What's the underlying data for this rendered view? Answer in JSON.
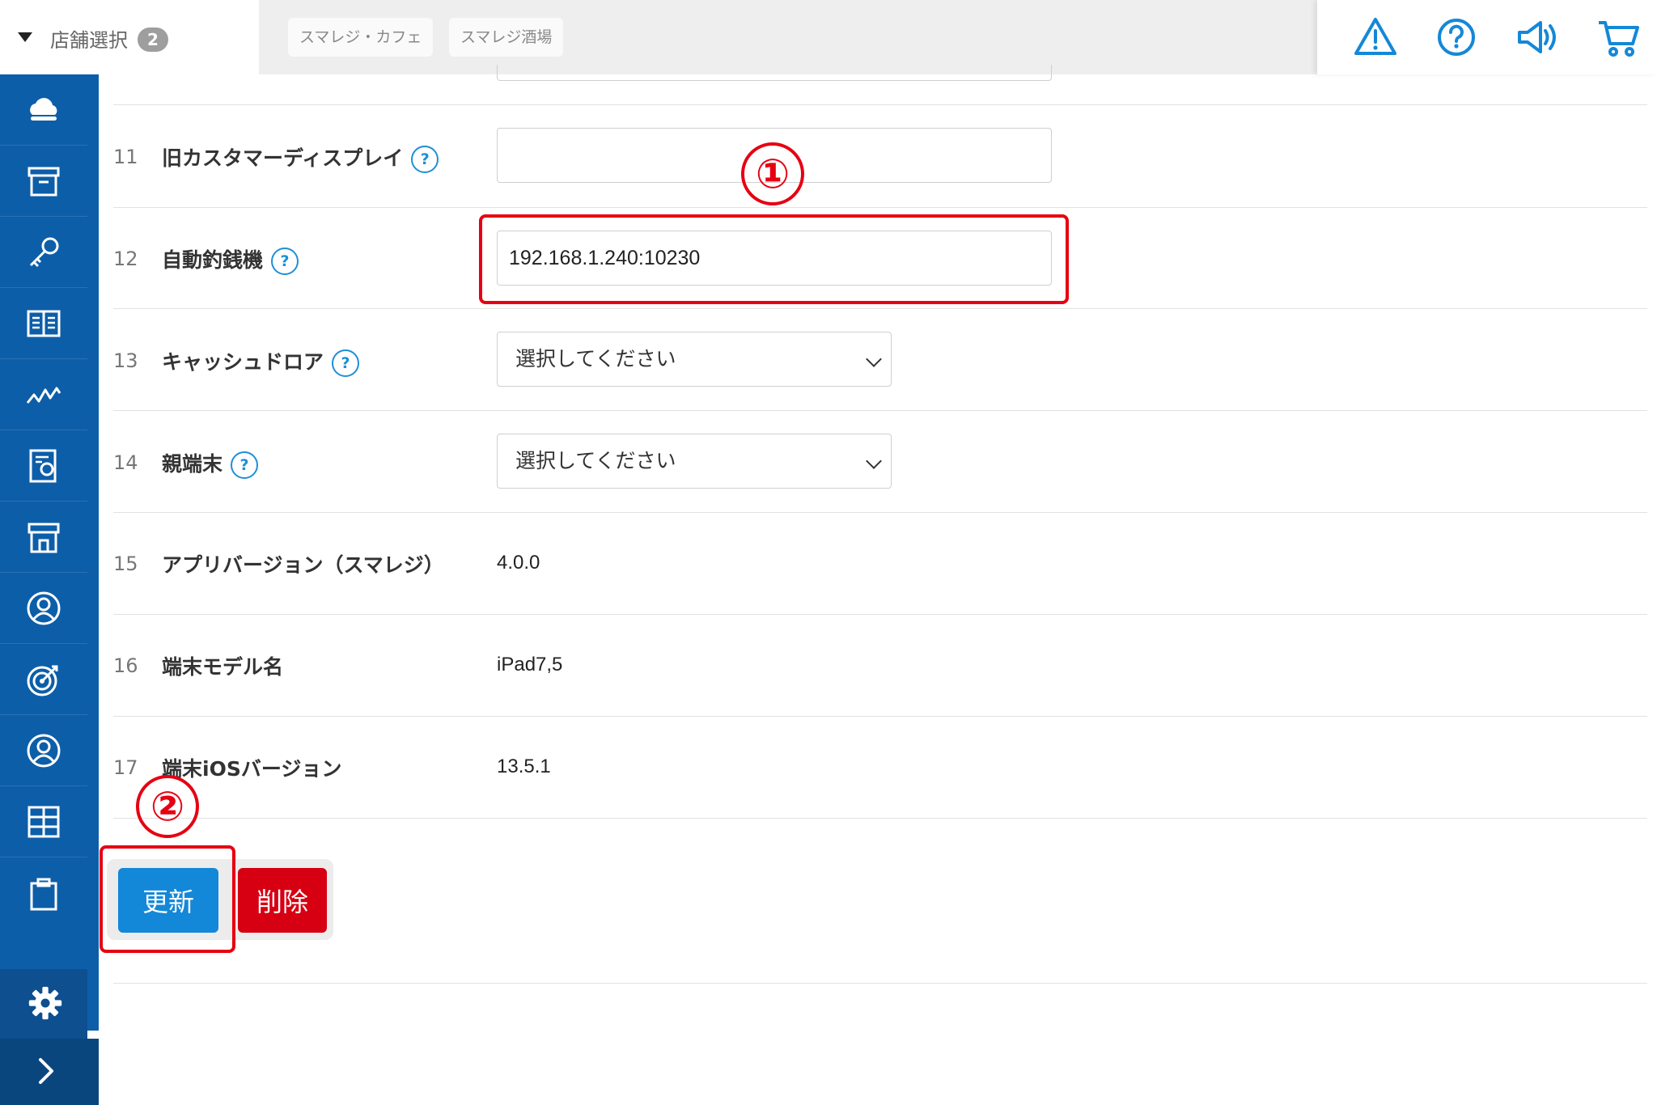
{
  "header": {
    "store_select_label": "店舗選択",
    "store_count": "2",
    "stores": [
      "スマレジ・カフェ",
      "スマレジ酒場"
    ],
    "icons": [
      "warning-icon",
      "help-circle-icon",
      "megaphone-icon",
      "cart-icon"
    ]
  },
  "sidebar": {
    "items": [
      "cloud-icon",
      "archive-box-icon",
      "key-icon",
      "book-icon",
      "chart-line-icon",
      "report-icon",
      "store-icon",
      "customer-icon",
      "target-icon",
      "staff-icon",
      "grid-icon",
      "clipboard-icon"
    ],
    "settings_icon": "gear-icon",
    "expand_icon": "chevron-right-icon"
  },
  "rows": [
    {
      "num": "11",
      "label": "旧カスタマーディスプレイ",
      "help": "?",
      "type": "input",
      "value": ""
    },
    {
      "num": "12",
      "label": "自動釣銭機",
      "help": "?",
      "type": "input",
      "value": "192.168.1.240:10230"
    },
    {
      "num": "13",
      "label": "キャッシュドロア",
      "help": "?",
      "type": "select",
      "value": "選択してください"
    },
    {
      "num": "14",
      "label": "親端末",
      "help": "?",
      "type": "select",
      "value": "選択してください"
    },
    {
      "num": "15",
      "label": "アプリバージョン（スマレジ）",
      "type": "text",
      "value": "4.0.0"
    },
    {
      "num": "16",
      "label": "端末モデル名",
      "type": "text",
      "value": "iPad7,5"
    },
    {
      "num": "17",
      "label": "端末iOSバージョン",
      "type": "text",
      "value": "13.5.1"
    }
  ],
  "buttons": {
    "update": "更新",
    "delete": "削除"
  },
  "annotations": {
    "step1": "①",
    "step2": "②",
    "color": "#e60012"
  }
}
